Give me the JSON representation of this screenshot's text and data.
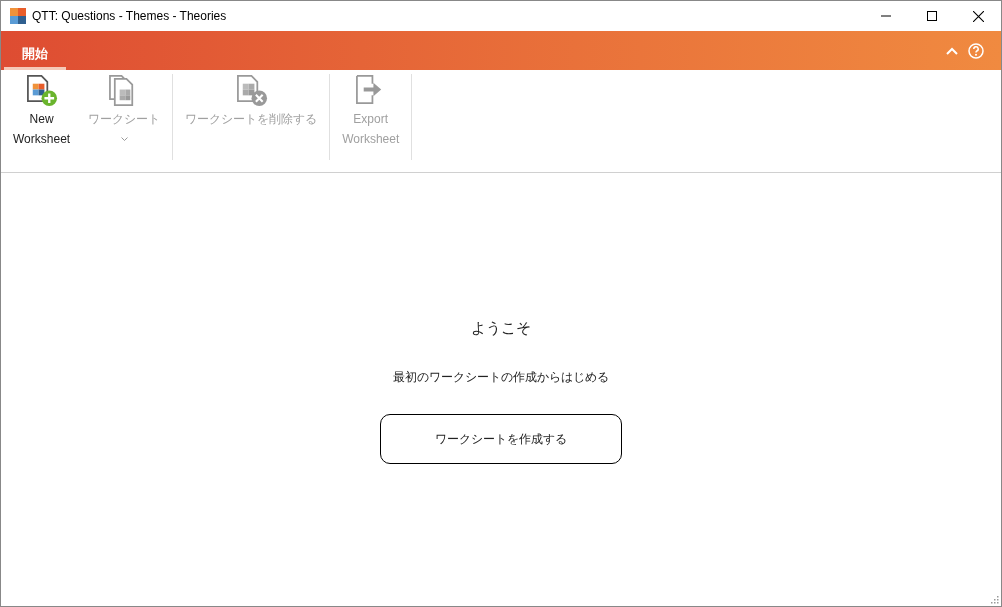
{
  "window": {
    "title": "QTT: Questions - Themes - Theories"
  },
  "ribbon": {
    "tabs": [
      {
        "label": "開始",
        "selected": true
      }
    ],
    "groups": [
      {
        "buttons": [
          {
            "kind": "new",
            "label": [
              "New",
              "Worksheet"
            ],
            "disabled": false,
            "dropdown": false
          },
          {
            "kind": "copy",
            "label": [
              "ワークシート"
            ],
            "disabled": true,
            "dropdown": true
          }
        ]
      },
      {
        "buttons": [
          {
            "kind": "delete",
            "label": [
              "ワークシートを削除する"
            ],
            "disabled": true,
            "dropdown": false
          }
        ]
      },
      {
        "buttons": [
          {
            "kind": "export",
            "label": [
              "Export",
              "Worksheet"
            ],
            "disabled": true,
            "dropdown": false
          }
        ]
      }
    ]
  },
  "welcome": {
    "title": "ようこそ",
    "subtitle": "最初のワークシートの作成からはじめる",
    "button": "ワークシートを作成する"
  }
}
